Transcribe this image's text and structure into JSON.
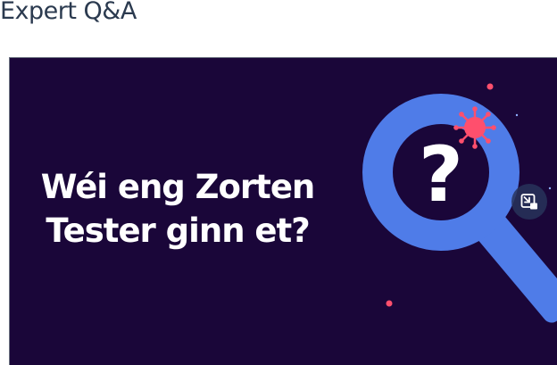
{
  "section": {
    "title": "Expert Q&A"
  },
  "video": {
    "headline_line1": "Wéi eng Zorten",
    "headline_line2": "Tester ginn et?",
    "magnifier_symbol": "?",
    "background_color": "#1a0639",
    "magnifier_color": "#4f7ce8",
    "virus_color": "#ff4f6d",
    "icons": {
      "magnifier": "magnifying-glass-icon",
      "virus": "virus-icon",
      "pip": "picture-in-picture-icon"
    }
  }
}
